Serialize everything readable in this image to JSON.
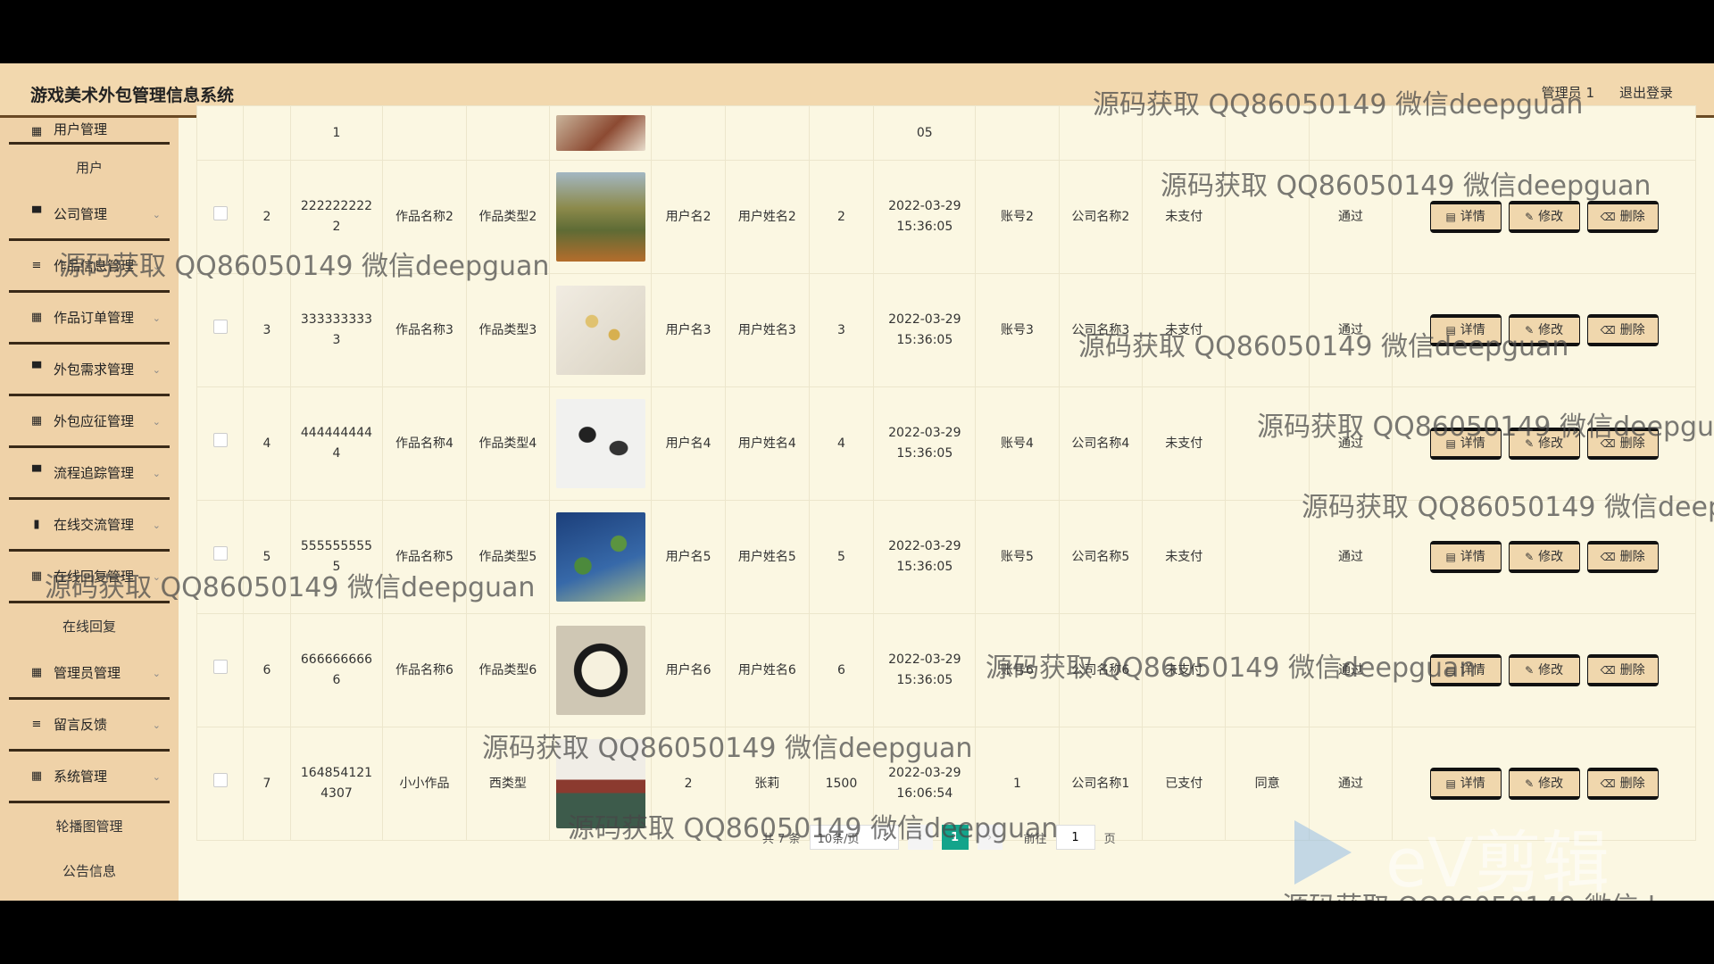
{
  "header": {
    "title": "游戏美术外包管理信息系统",
    "user": "管理员 1",
    "logout": "退出登录"
  },
  "sidebar": {
    "items": [
      {
        "label": "用户管理",
        "icon": "grid-icon",
        "partial": true
      },
      {
        "label": "用户",
        "sub": true
      },
      {
        "label": "公司管理",
        "icon": "flag-icon"
      },
      {
        "label": "作品信息管理",
        "icon": "list-icon"
      },
      {
        "label": "作品订单管理",
        "icon": "table-icon"
      },
      {
        "label": "外包需求管理",
        "icon": "flag-icon"
      },
      {
        "label": "外包应征管理",
        "icon": "grid-icon"
      },
      {
        "label": "流程追踪管理",
        "icon": "flag-icon"
      },
      {
        "label": "在线交流管理",
        "icon": "chart-icon"
      },
      {
        "label": "在线回复管理",
        "icon": "grid-icon"
      },
      {
        "label": "在线回复",
        "sub": true
      },
      {
        "label": "管理员管理",
        "icon": "grid-icon"
      },
      {
        "label": "留言反馈",
        "icon": "list-icon"
      },
      {
        "label": "系统管理",
        "icon": "grid-icon"
      },
      {
        "label": "轮播图管理",
        "sub": true
      },
      {
        "label": "公告信息",
        "sub": true
      }
    ]
  },
  "rows": [
    {
      "idx": "",
      "code": "1",
      "name": "",
      "type": "",
      "thumb": "artwork-thumbnail",
      "user": "",
      "realname": "",
      "qty": "",
      "time": "05",
      "account": "",
      "company": "",
      "pay": "",
      "agree": "",
      "audit": ""
    },
    {
      "idx": "2",
      "code": "2222222222",
      "name": "作品名称2",
      "type": "作品类型2",
      "thumb": "landscape-thumbnail",
      "user": "用户名2",
      "realname": "用户姓名2",
      "qty": "2",
      "time": "2022-03-29 15:36:05",
      "account": "账号2",
      "company": "公司名称2",
      "pay": "未支付",
      "agree": "",
      "audit": "通过"
    },
    {
      "idx": "3",
      "code": "3333333333",
      "name": "作品名称3",
      "type": "作品类型3",
      "thumb": "flower-thumbnail",
      "user": "用户名3",
      "realname": "用户姓名3",
      "qty": "3",
      "time": "2022-03-29 15:36:05",
      "account": "账号3",
      "company": "公司名称3",
      "pay": "未支付",
      "agree": "",
      "audit": "通过"
    },
    {
      "idx": "4",
      "code": "4444444444",
      "name": "作品名称4",
      "type": "作品类型4",
      "thumb": "cranes-thumbnail",
      "user": "用户名4",
      "realname": "用户姓名4",
      "qty": "4",
      "time": "2022-03-29 15:36:05",
      "account": "账号4",
      "company": "公司名称4",
      "pay": "未支付",
      "agree": "",
      "audit": "通过"
    },
    {
      "idx": "5",
      "code": "5555555555",
      "name": "作品名称5",
      "type": "作品类型5",
      "thumb": "water-lilies-thumbnail",
      "user": "用户名5",
      "realname": "用户姓名5",
      "qty": "5",
      "time": "2022-03-29 15:36:05",
      "account": "账号5",
      "company": "公司名称5",
      "pay": "未支付",
      "agree": "",
      "audit": "通过"
    },
    {
      "idx": "6",
      "code": "6666666666",
      "name": "作品名称6",
      "type": "作品类型6",
      "thumb": "framed-flower-thumbnail",
      "user": "用户名6",
      "realname": "用户姓名6",
      "qty": "6",
      "time": "2022-03-29 15:36:05",
      "account": "账号6",
      "company": "公司名称6",
      "pay": "未支付",
      "agree": "",
      "audit": "通过"
    },
    {
      "idx": "7",
      "code": "1648541214307",
      "name": "小小作品",
      "type": "西类型",
      "thumb": "jiangnan-poster-thumbnail",
      "user": "2",
      "realname": "张莉",
      "qty": "1500",
      "time": "2022-03-29 16:06:54",
      "account": "1",
      "company": "公司名称1",
      "pay": "已支付",
      "agree": "同意",
      "audit": "通过"
    }
  ],
  "actions": {
    "detail": "详情",
    "edit": "修改",
    "delete": "删除"
  },
  "pager": {
    "total": "共 7 条",
    "page_size": "10条/页",
    "current": "1",
    "goto_label": "前往",
    "goto_value": "1",
    "page_suffix": "页"
  },
  "watermark": "源码获取 QQ86050149 微信deepguan",
  "logo_watermark": "eV剪辑",
  "colors": {
    "header_bg": "#f2d8ae",
    "sidebar_bg": "#efd2a8",
    "content_bg": "#fbf7e2",
    "page_active": "#13a48b"
  }
}
